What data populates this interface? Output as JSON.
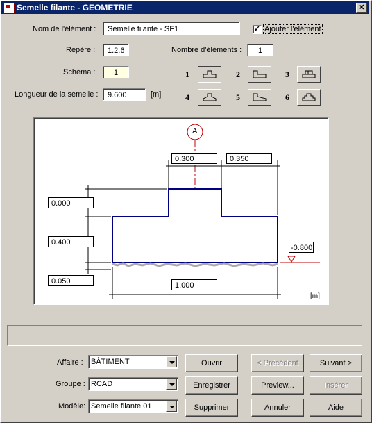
{
  "window": {
    "title": "Semelle filante - GEOMETRIE",
    "close": "✕"
  },
  "form": {
    "nom_label": "Nom de l'élément :",
    "nom_value": "Semelle filante - SF1",
    "ajouter_label": "Ajouter l'élément",
    "ajouter_checked": "✓",
    "repere_label": "Repère :",
    "repere_value": "1.2.6",
    "nombre_label": "Nombre d'éléments :",
    "nombre_value": "1",
    "schema_label": "Schéma :",
    "schema_value": "1",
    "longueur_label": "Longueur de la semelle :",
    "longueur_value": "9.600",
    "longueur_unit": "[m]"
  },
  "schemas": [
    {
      "num": "1",
      "icon": "inverted-t-icon",
      "selected": true
    },
    {
      "num": "2",
      "icon": "l-shape-icon",
      "selected": false
    },
    {
      "num": "3",
      "icon": "offset-step-icon",
      "selected": false
    },
    {
      "num": "4",
      "icon": "tapered-icon",
      "selected": false
    },
    {
      "num": "5",
      "icon": "tapered-l-icon",
      "selected": false
    },
    {
      "num": "6",
      "icon": "stepped-icon",
      "selected": false
    }
  ],
  "drawing": {
    "axis_label": "A",
    "dim_top_left": "0.300",
    "dim_top_right": "0.350",
    "dim_left_1": "0.000",
    "dim_left_2": "0.400",
    "dim_left_3": "0.050",
    "dim_bottom": "1.000",
    "level": "-0.800",
    "unit": "[m]"
  },
  "bottom": {
    "affaire_label": "Affaire :",
    "affaire_value": "BÂTIMENT",
    "groupe_label": "Groupe :",
    "groupe_value": "RCAD",
    "modele_label": "Modèle:",
    "modele_value": "Semelle filante 01"
  },
  "buttons": {
    "ouvrir": "Ouvrir",
    "precedent": "< Précédent",
    "suivant": "Suivant  >",
    "enregistrer": "Enregistrer",
    "preview": "Preview...",
    "inserer": "Insérer",
    "supprimer": "Supprimer",
    "annuler": "Annuler",
    "aide": "Aide"
  }
}
